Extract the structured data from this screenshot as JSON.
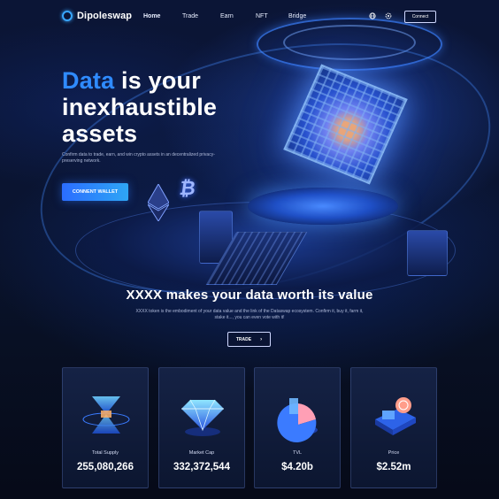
{
  "brand": {
    "name": "Dipoleswap",
    "logo_icon": "ring-logo-icon"
  },
  "nav": {
    "items": [
      {
        "label": "Home",
        "active": true
      },
      {
        "label": "Trade",
        "active": false
      },
      {
        "label": "Earn",
        "active": false
      },
      {
        "label": "NFT",
        "active": false
      },
      {
        "label": "Bridge",
        "active": false
      }
    ],
    "icons": [
      "globe-icon",
      "settings-icon"
    ],
    "connect_label": "Connect"
  },
  "hero": {
    "title_accent": "Data",
    "title_line1_rest": " is your",
    "title_line2": "inexhaustible",
    "title_line3": "assets",
    "subtitle": "Confirm data to trade, earn, and win crypto assets in an decentralized privacy-preserving network.",
    "cta_label": "CONNENT WALLET"
  },
  "value_section": {
    "title": "XXXX makes your data worth its value",
    "subtitle": "XXXX token is the embodiment of your data value and the link of the Dataswap ecosystem. Confirm it, buy it, farm it, stake it..., you can even vote with it!",
    "trade_label": "TRADE",
    "trade_icon": "chevron-right-icon"
  },
  "stats": [
    {
      "label": "Total Supply",
      "value": "255,080,266",
      "icon": "hourglass-crystal-icon"
    },
    {
      "label": "Market Cap",
      "value": "332,372,544",
      "icon": "diamond-icon"
    },
    {
      "label": "TVL",
      "value": "$4.20b",
      "icon": "pie-chart-icon"
    },
    {
      "label": "Price",
      "value": "$2.52m",
      "icon": "coin-stack-icon"
    }
  ],
  "colors": {
    "accent": "#2f8bff",
    "background": "#070c1c",
    "card": "#131f40",
    "button_gradient_start": "#2b6dff",
    "button_gradient_end": "#2ea6f5"
  }
}
